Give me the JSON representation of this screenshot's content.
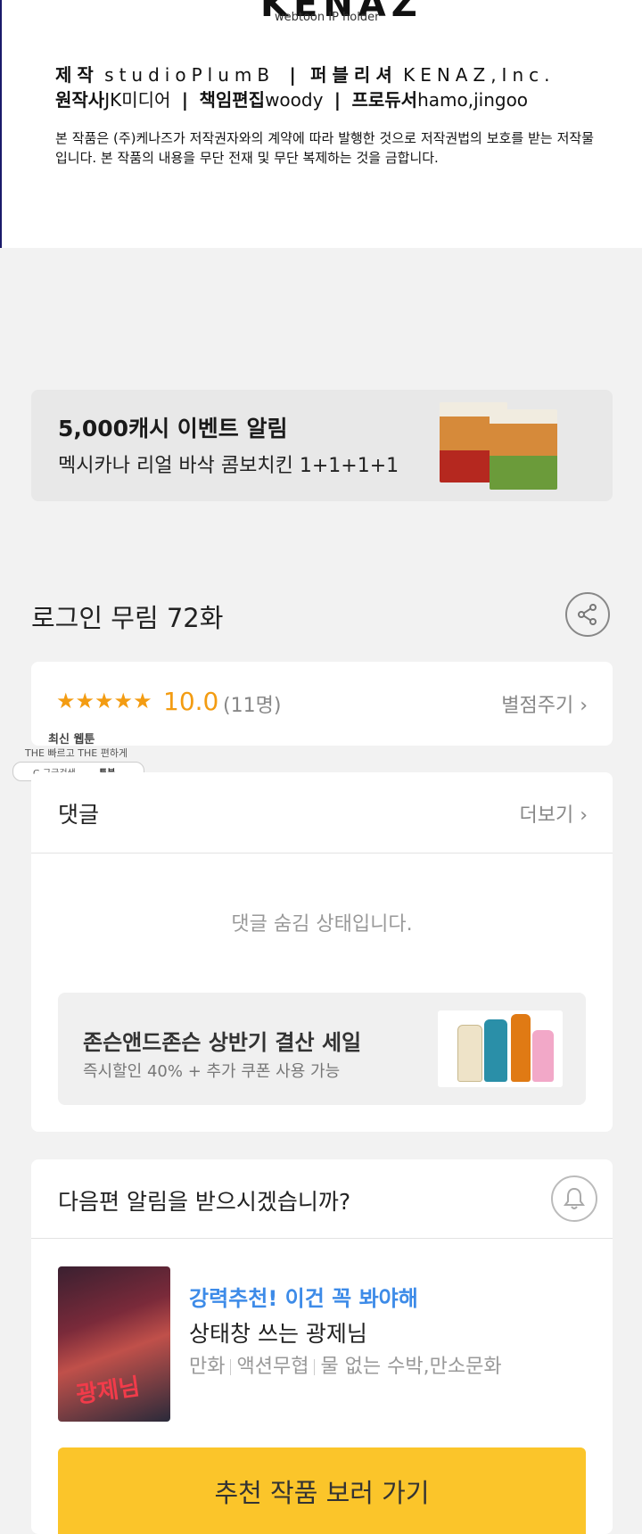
{
  "credits": {
    "logo_text": "KENAZ",
    "logo_sub": "webtoon IP holder",
    "line1": {
      "producer_label": "제작",
      "producer_value": "studioPlumB",
      "sep1": "|",
      "publisher_label": "퍼블리셔",
      "publisher_value": "KENAZ,Inc."
    },
    "line2": {
      "original_label": "원작사",
      "original_value": "JK미디어",
      "sep1": "|",
      "editor_label": "책임편집",
      "editor_value": "woody",
      "sep2": "|",
      "pd_label": "프로듀서",
      "pd_value": "hamo,jingoo"
    },
    "notice": "본 작품은 (주)케나즈가 저작권자와의 계약에 따라 발행한 것으로 저작권법의 보호를 받는 저작물입니다. 본 작품의 내용을 무단 전재 및 무단 복제하는 것을 금합니다."
  },
  "ad_banner": {
    "title": "5,000캐시 이벤트 알림",
    "desc": "멕시카나 리얼 바삭 콤보치킨 1+1+1+1"
  },
  "episode": {
    "title": "로그인 무림 72화"
  },
  "rating": {
    "stars": "★★★★★",
    "score": "10.0",
    "count": "(11명)",
    "rate_link": "별점주기 ›"
  },
  "watermark": {
    "line1": "최신 웹툰",
    "line2": "THE 빠르고 THE 편하게",
    "search": "G 구글검색",
    "brand": "툰북"
  },
  "comments": {
    "header": "댓글",
    "more": "더보기 ›",
    "hidden_msg": "댓글 숨김 상태입니다.",
    "ad_title": "존슨앤드존슨 상반기 결산 세일",
    "ad_desc": "즉시할인 40% + 추가 쿠폰 사용 가능"
  },
  "next": {
    "question": "다음편 알림을 받으시겠습니까?",
    "rec_tag": "강력추천! 이건 꼭 봐야해",
    "rec_title": "상태창 쓰는 광제님",
    "rec_genre1": "만화",
    "rec_genre2": "액션무협",
    "rec_genre3": "물 없는 수박,만소문화",
    "thumb_title": "광제님",
    "cta": "추천 작품 보러 가기"
  },
  "colors": {
    "accent_orange": "#f39c12",
    "accent_blue": "#3d8be8",
    "cta_yellow": "#fbc52a"
  }
}
